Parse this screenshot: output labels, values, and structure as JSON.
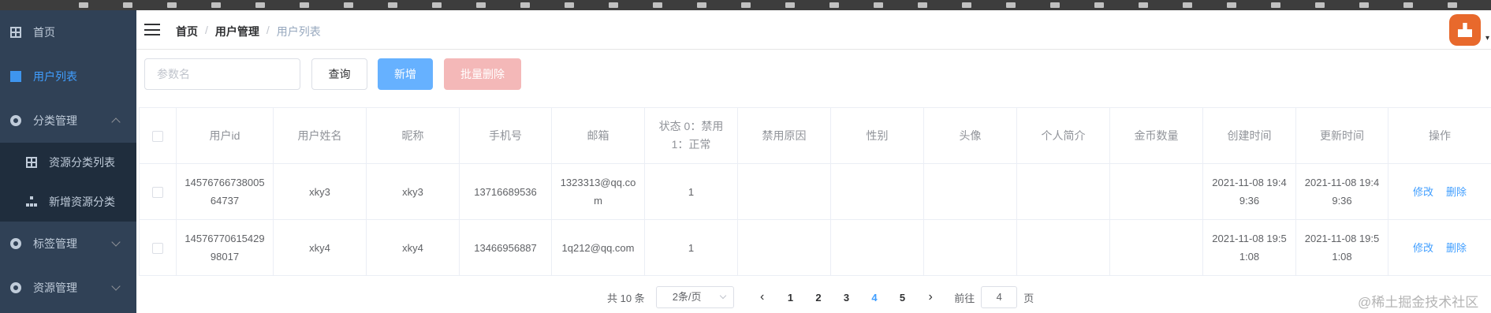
{
  "sidebar": {
    "items": [
      {
        "label": "首页"
      },
      {
        "label": "用户列表"
      },
      {
        "label": "分类管理"
      },
      {
        "label": "资源分类列表"
      },
      {
        "label": "新增资源分类"
      },
      {
        "label": "标签管理"
      },
      {
        "label": "资源管理"
      }
    ]
  },
  "breadcrumb": {
    "home": "首页",
    "section": "用户管理",
    "current": "用户列表",
    "sep": "/"
  },
  "search": {
    "placeholder": "参数名"
  },
  "toolbar": {
    "query": "查询",
    "add": "新增",
    "batch_delete": "批量删除"
  },
  "table": {
    "headers": [
      "用户id",
      "用户姓名",
      "昵称",
      "手机号",
      "邮箱",
      "状态 0：禁用 1：正常",
      "禁用原因",
      "性别",
      "头像",
      "个人简介",
      "金币数量",
      "创建时间",
      "更新时间",
      "操作"
    ],
    "rows": [
      {
        "id": "1457676673800564737",
        "name": "xky3",
        "nickname": "xky3",
        "phone": "13716689536",
        "email": "1323313@qq.com",
        "status": "1",
        "reason": "",
        "gender": "",
        "avatar": "",
        "bio": "",
        "coins": "",
        "created": "2021-11-08 19:49:36",
        "updated": "2021-11-08 19:49:36",
        "edit": "修改",
        "delete": "删除"
      },
      {
        "id": "1457677061542998017",
        "name": "xky4",
        "nickname": "xky4",
        "phone": "13466956887",
        "email": "1q212@qq.com",
        "status": "1",
        "reason": "",
        "gender": "",
        "avatar": "",
        "bio": "",
        "coins": "",
        "created": "2021-11-08 19:51:08",
        "updated": "2021-11-08 19:51:08",
        "edit": "修改",
        "delete": "删除"
      }
    ]
  },
  "pagination": {
    "total": "共 10 条",
    "page_size": "2条/页",
    "prev": "‹",
    "next": "›",
    "pages": [
      "1",
      "2",
      "3",
      "4",
      "5"
    ],
    "current_page": "4",
    "goto_label": "前往",
    "goto_value": "4",
    "goto_suffix": "页"
  },
  "watermark": "@稀土掘金技术社区",
  "colors": {
    "sidebar_bg": "#304156",
    "primary": "#409eff",
    "danger_disabled": "#f4b8b8",
    "avatar_bg": "#e8692c"
  }
}
